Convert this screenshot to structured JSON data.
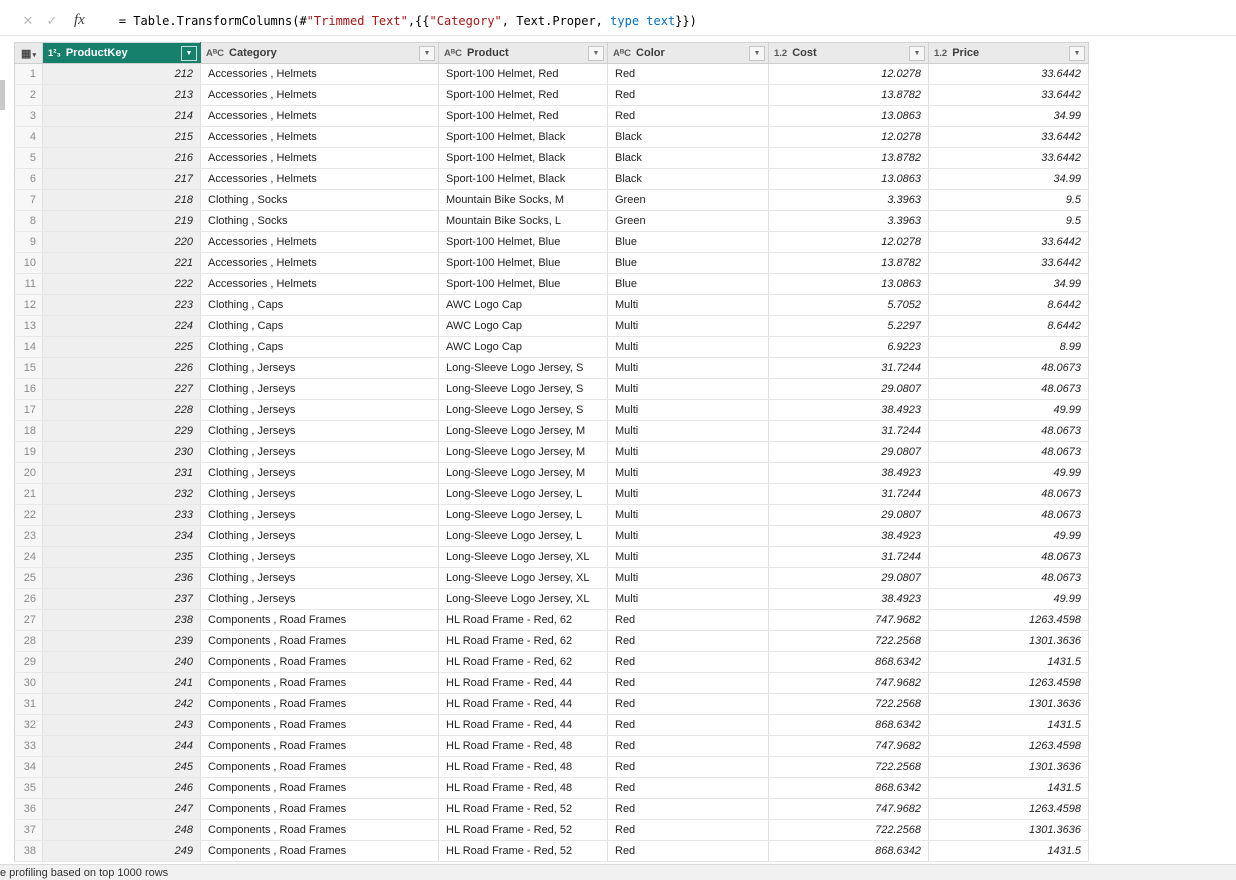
{
  "colors": {
    "selected_header": "#16806c",
    "string_literal": "#a31515",
    "keyword": "#0070c0"
  },
  "formula_bar": {
    "cancel_glyph": "✕",
    "accept_glyph": "✓",
    "fx_label": "fx",
    "parts": [
      {
        "text": "= Table.TransformColumns(#",
        "color": "#000000"
      },
      {
        "text": "\"Trimmed Text\"",
        "color": "#a31515"
      },
      {
        "text": ",{{",
        "color": "#000000"
      },
      {
        "text": "\"Category\"",
        "color": "#a31515"
      },
      {
        "text": ", Text.Proper, ",
        "color": "#000000"
      },
      {
        "text": "type text",
        "color": "#0070c0"
      },
      {
        "text": "}})",
        "color": "#000000"
      }
    ]
  },
  "grid": {
    "corner_glyph": "▦",
    "corner_arrow": "▾",
    "filter_glyph": "▼",
    "columns": [
      {
        "name": "ProductKey",
        "type": "whole-number",
        "glyph": "1²₃",
        "selected": true
      },
      {
        "name": "Category",
        "type": "text",
        "glyph": "AᴮC",
        "selected": false
      },
      {
        "name": "Product",
        "type": "text",
        "glyph": "AᴮC",
        "selected": false
      },
      {
        "name": "Color",
        "type": "text",
        "glyph": "AᴮC",
        "selected": false
      },
      {
        "name": "Cost",
        "type": "decimal",
        "glyph": "1.2",
        "selected": false
      },
      {
        "name": "Price",
        "type": "decimal",
        "glyph": "1.2",
        "selected": false
      }
    ],
    "rows": [
      [
        "1",
        "212",
        "Accessories , Helmets",
        "Sport-100 Helmet, Red",
        "Red",
        "12.0278",
        "33.6442"
      ],
      [
        "2",
        "213",
        "Accessories , Helmets",
        "Sport-100 Helmet, Red",
        "Red",
        "13.8782",
        "33.6442"
      ],
      [
        "3",
        "214",
        "Accessories , Helmets",
        "Sport-100 Helmet, Red",
        "Red",
        "13.0863",
        "34.99"
      ],
      [
        "4",
        "215",
        "Accessories , Helmets",
        "Sport-100 Helmet, Black",
        "Black",
        "12.0278",
        "33.6442"
      ],
      [
        "5",
        "216",
        "Accessories , Helmets",
        "Sport-100 Helmet, Black",
        "Black",
        "13.8782",
        "33.6442"
      ],
      [
        "6",
        "217",
        "Accessories , Helmets",
        "Sport-100 Helmet, Black",
        "Black",
        "13.0863",
        "34.99"
      ],
      [
        "7",
        "218",
        "Clothing , Socks",
        "Mountain Bike Socks, M",
        "Green",
        "3.3963",
        "9.5"
      ],
      [
        "8",
        "219",
        "Clothing , Socks",
        "Mountain Bike Socks, L",
        "Green",
        "3.3963",
        "9.5"
      ],
      [
        "9",
        "220",
        "Accessories , Helmets",
        "Sport-100 Helmet, Blue",
        "Blue",
        "12.0278",
        "33.6442"
      ],
      [
        "10",
        "221",
        "Accessories , Helmets",
        "Sport-100 Helmet, Blue",
        "Blue",
        "13.8782",
        "33.6442"
      ],
      [
        "11",
        "222",
        "Accessories , Helmets",
        "Sport-100 Helmet, Blue",
        "Blue",
        "13.0863",
        "34.99"
      ],
      [
        "12",
        "223",
        "Clothing , Caps",
        "AWC Logo Cap",
        "Multi",
        "5.7052",
        "8.6442"
      ],
      [
        "13",
        "224",
        "Clothing , Caps",
        "AWC Logo Cap",
        "Multi",
        "5.2297",
        "8.6442"
      ],
      [
        "14",
        "225",
        "Clothing , Caps",
        "AWC Logo Cap",
        "Multi",
        "6.9223",
        "8.99"
      ],
      [
        "15",
        "226",
        "Clothing , Jerseys",
        "Long-Sleeve Logo Jersey, S",
        "Multi",
        "31.7244",
        "48.0673"
      ],
      [
        "16",
        "227",
        "Clothing , Jerseys",
        "Long-Sleeve Logo Jersey, S",
        "Multi",
        "29.0807",
        "48.0673"
      ],
      [
        "17",
        "228",
        "Clothing , Jerseys",
        "Long-Sleeve Logo Jersey, S",
        "Multi",
        "38.4923",
        "49.99"
      ],
      [
        "18",
        "229",
        "Clothing , Jerseys",
        "Long-Sleeve Logo Jersey, M",
        "Multi",
        "31.7244",
        "48.0673"
      ],
      [
        "19",
        "230",
        "Clothing , Jerseys",
        "Long-Sleeve Logo Jersey, M",
        "Multi",
        "29.0807",
        "48.0673"
      ],
      [
        "20",
        "231",
        "Clothing , Jerseys",
        "Long-Sleeve Logo Jersey, M",
        "Multi",
        "38.4923",
        "49.99"
      ],
      [
        "21",
        "232",
        "Clothing , Jerseys",
        "Long-Sleeve Logo Jersey, L",
        "Multi",
        "31.7244",
        "48.0673"
      ],
      [
        "22",
        "233",
        "Clothing , Jerseys",
        "Long-Sleeve Logo Jersey, L",
        "Multi",
        "29.0807",
        "48.0673"
      ],
      [
        "23",
        "234",
        "Clothing , Jerseys",
        "Long-Sleeve Logo Jersey, L",
        "Multi",
        "38.4923",
        "49.99"
      ],
      [
        "24",
        "235",
        "Clothing , Jerseys",
        "Long-Sleeve Logo Jersey, XL",
        "Multi",
        "31.7244",
        "48.0673"
      ],
      [
        "25",
        "236",
        "Clothing , Jerseys",
        "Long-Sleeve Logo Jersey, XL",
        "Multi",
        "29.0807",
        "48.0673"
      ],
      [
        "26",
        "237",
        "Clothing , Jerseys",
        "Long-Sleeve Logo Jersey, XL",
        "Multi",
        "38.4923",
        "49.99"
      ],
      [
        "27",
        "238",
        "Components , Road Frames",
        "HL Road Frame - Red, 62",
        "Red",
        "747.9682",
        "1263.4598"
      ],
      [
        "28",
        "239",
        "Components , Road Frames",
        "HL Road Frame - Red, 62",
        "Red",
        "722.2568",
        "1301.3636"
      ],
      [
        "29",
        "240",
        "Components , Road Frames",
        "HL Road Frame - Red, 62",
        "Red",
        "868.6342",
        "1431.5"
      ],
      [
        "30",
        "241",
        "Components , Road Frames",
        "HL Road Frame - Red, 44",
        "Red",
        "747.9682",
        "1263.4598"
      ],
      [
        "31",
        "242",
        "Components , Road Frames",
        "HL Road Frame - Red, 44",
        "Red",
        "722.2568",
        "1301.3636"
      ],
      [
        "32",
        "243",
        "Components , Road Frames",
        "HL Road Frame - Red, 44",
        "Red",
        "868.6342",
        "1431.5"
      ],
      [
        "33",
        "244",
        "Components , Road Frames",
        "HL Road Frame - Red, 48",
        "Red",
        "747.9682",
        "1263.4598"
      ],
      [
        "34",
        "245",
        "Components , Road Frames",
        "HL Road Frame - Red, 48",
        "Red",
        "722.2568",
        "1301.3636"
      ],
      [
        "35",
        "246",
        "Components , Road Frames",
        "HL Road Frame - Red, 48",
        "Red",
        "868.6342",
        "1431.5"
      ],
      [
        "36",
        "247",
        "Components , Road Frames",
        "HL Road Frame - Red, 52",
        "Red",
        "747.9682",
        "1263.4598"
      ],
      [
        "37",
        "248",
        "Components , Road Frames",
        "HL Road Frame - Red, 52",
        "Red",
        "722.2568",
        "1301.3636"
      ],
      [
        "38",
        "249",
        "Components , Road Frames",
        "HL Road Frame - Red, 52",
        "Red",
        "868.6342",
        "1431.5"
      ]
    ]
  },
  "status_bar": {
    "text": "e profiling based on top 1000 rows"
  }
}
